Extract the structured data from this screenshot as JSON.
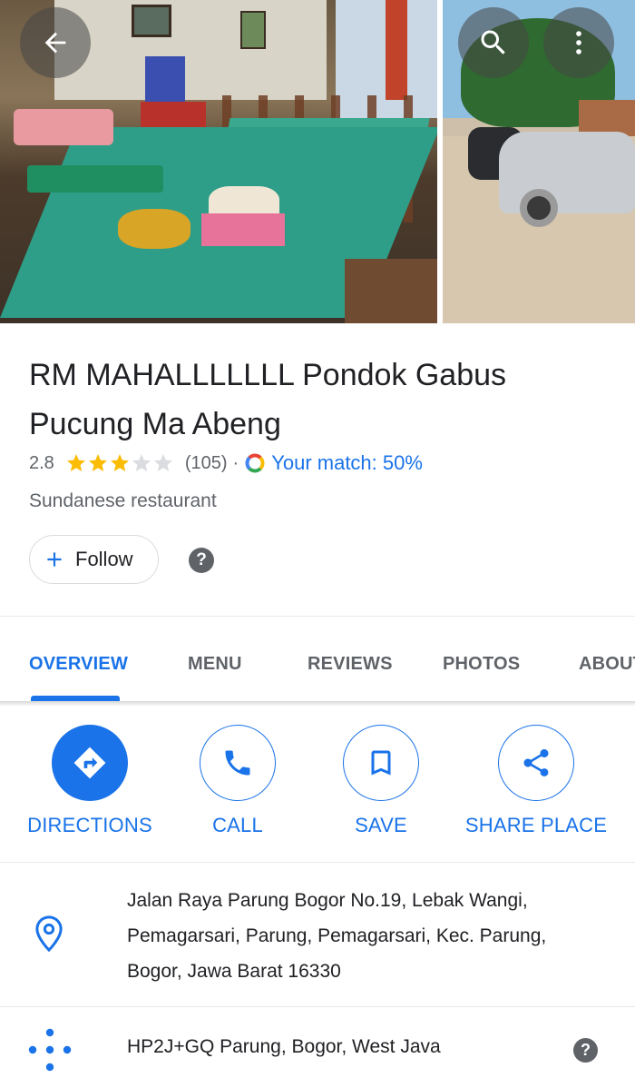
{
  "header": {
    "back_icon": "arrow-left-icon",
    "search_icon": "search-icon",
    "more_icon": "more-vert-icon",
    "photos": [
      "restaurant-interior-photo",
      "parking-lot-photo"
    ]
  },
  "place": {
    "name": "RM MAHALLLLLLL Pondok Gabus Pucung Ma Abeng",
    "rating": "2.8",
    "rating_value": 2.8,
    "stars_filled": 3,
    "stars_total": 5,
    "review_count": "(105)",
    "separator": "·",
    "match_text": "Your match: 50%",
    "category": "Sundanese restaurant"
  },
  "follow": {
    "label": "Follow",
    "help": "?"
  },
  "tabs": [
    {
      "label": "OVERVIEW",
      "active": true
    },
    {
      "label": "MENU",
      "active": false
    },
    {
      "label": "REVIEWS",
      "active": false
    },
    {
      "label": "PHOTOS",
      "active": false
    },
    {
      "label": "ABOUT",
      "active": false
    }
  ],
  "actions": [
    {
      "label": "DIRECTIONS",
      "icon": "directions-icon"
    },
    {
      "label": "CALL",
      "icon": "phone-icon"
    },
    {
      "label": "SAVE",
      "icon": "bookmark-icon"
    },
    {
      "label": "SHARE PLACE",
      "icon": "share-icon"
    }
  ],
  "info": {
    "address_lines": [
      "Jalan Raya Parung Bogor No.19, Lebak Wangi,",
      "Pemagarsari, Parung, Pemagarsari, Kec. Parung,",
      "Bogor, Jawa Barat 16330"
    ],
    "plus_code": "HP2J+GQ Parung, Bogor, West Java",
    "plus_code_help": "?"
  },
  "colors": {
    "accent": "#1a73e8",
    "star": "#fbbc04",
    "star_empty": "#dadce0",
    "secondary_text": "#5f6368"
  }
}
